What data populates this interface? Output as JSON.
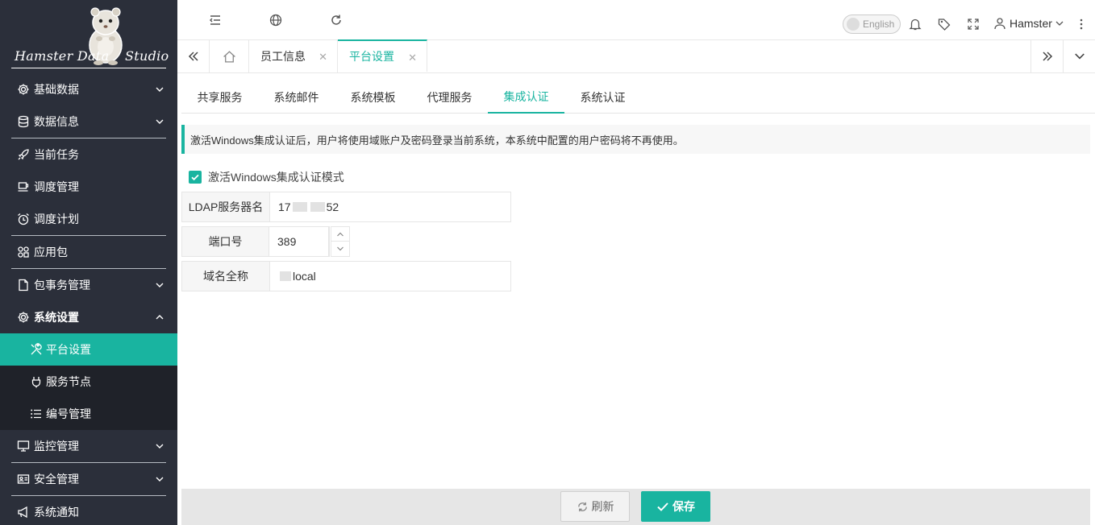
{
  "logo": {
    "text_left": "Hamster Data",
    "text_right": "Studio",
    "image": "hamster-mascot"
  },
  "sidebar": {
    "items": [
      {
        "label": "基础数据",
        "icon": "gear-icon",
        "expanded": false
      },
      {
        "label": "数据信息",
        "icon": "database-icon",
        "expanded": false
      },
      {
        "label": "当前任务",
        "icon": "rocket-icon"
      },
      {
        "label": "调度管理",
        "icon": "cup-icon"
      },
      {
        "label": "调度计划",
        "icon": "alarm-icon"
      },
      {
        "label": "应用包",
        "icon": "apps-icon"
      },
      {
        "label": "包事务管理",
        "icon": "file-icon",
        "expanded": false
      },
      {
        "label": "系统设置",
        "icon": "gear-icon",
        "expanded": true
      },
      {
        "label": "监控管理",
        "icon": "monitor-icon",
        "expanded": false
      },
      {
        "label": "安全管理",
        "icon": "id-card-icon",
        "expanded": false
      },
      {
        "label": "系统通知",
        "icon": "megaphone-icon"
      }
    ],
    "subitems": [
      {
        "label": "平台设置",
        "icon": "tools-icon",
        "active": true
      },
      {
        "label": "服务节点",
        "icon": "plug-icon",
        "active": false
      },
      {
        "label": "编号管理",
        "icon": "list-icon",
        "active": false
      }
    ]
  },
  "topbar": {
    "language_toggle": "English",
    "user_name": "Hamster"
  },
  "page_tabs": [
    {
      "label": "员工信息",
      "active": false
    },
    {
      "label": "平台设置",
      "active": true
    }
  ],
  "inner_tabs": [
    {
      "label": "共享服务",
      "active": false
    },
    {
      "label": "系统邮件",
      "active": false
    },
    {
      "label": "系统模板",
      "active": false
    },
    {
      "label": "代理服务",
      "active": false
    },
    {
      "label": "集成认证",
      "active": true
    },
    {
      "label": "系统认证",
      "active": false
    }
  ],
  "notice": "激活Windows集成认证后，用户将使用域账户及密码登录当前系统，本系统中配置的用户密码将不再使用。",
  "form": {
    "checkbox_label": "激活Windows集成认证模式",
    "checkbox_checked": true,
    "ldap_label": "LDAP服务器名",
    "ldap_value_start": "17",
    "ldap_value_end": "52",
    "port_label": "端口号",
    "port_value": "389",
    "domain_label": "域名全称",
    "domain_value_end": "local"
  },
  "footer": {
    "refresh_label": "刷新",
    "save_label": "保存"
  },
  "colors": {
    "accent": "#19b4a0",
    "sidebar_bg": "#2b2f3a",
    "submenu_bg": "#1f2229"
  }
}
